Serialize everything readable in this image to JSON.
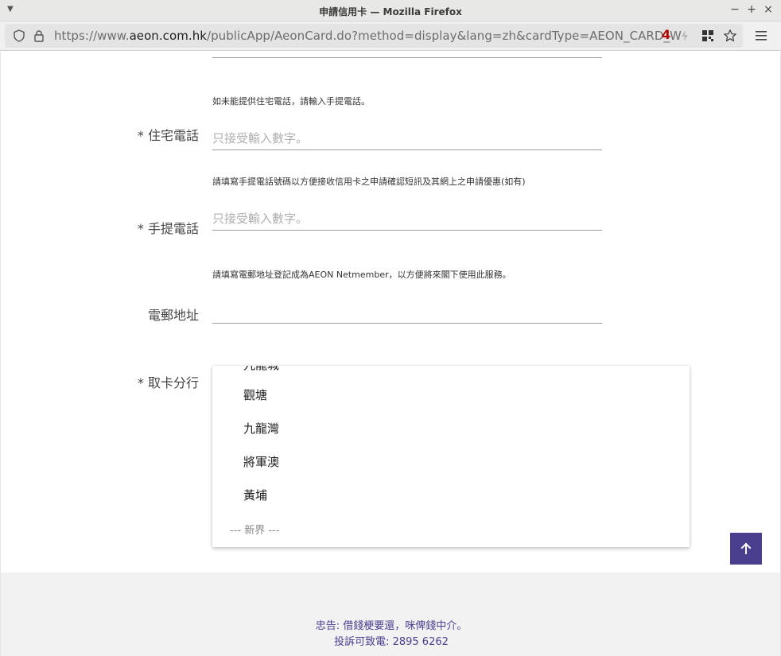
{
  "window": {
    "title": "申請信用卡 — Mozilla Firefox"
  },
  "browser": {
    "url_prefix": "https://www.",
    "url_host": "aeon.com.hk",
    "url_path": "/publicApp/AeonCard.do?method=display&lang=zh&cardType=AEON_CARD_W",
    "extension_badge": "4"
  },
  "form": {
    "home_phone": {
      "hint": "如未能提供住宅電話，請輸入手提電話。",
      "label": "* 住宅電話",
      "placeholder": "只接受輸入數字。"
    },
    "mobile_phone": {
      "hint": "請填寫手提電話號碼以方便接收信用卡之申請確認短訊及其網上之申請優惠(如有)",
      "label": "* 手提電話",
      "placeholder": "只接受輸入數字。"
    },
    "email": {
      "hint": "請填寫電郵地址登記成為AEON Netmember，以方便將來閣下使用此服務。",
      "label": "電郵地址",
      "value": ""
    },
    "branch": {
      "label": "* 取卡分行",
      "options": [
        {
          "label": "觀塘"
        },
        {
          "label": "九龍灣"
        },
        {
          "label": "將軍澳"
        },
        {
          "label": "黃埔"
        }
      ],
      "group_label": "--- 新界 ---"
    }
  },
  "footer": {
    "warning": "忠告: 借錢梗要還，咪俾錢中介。",
    "complaint": "投訴可致電: 2895 6262"
  },
  "colors": {
    "accent": "#4a3f8f"
  }
}
